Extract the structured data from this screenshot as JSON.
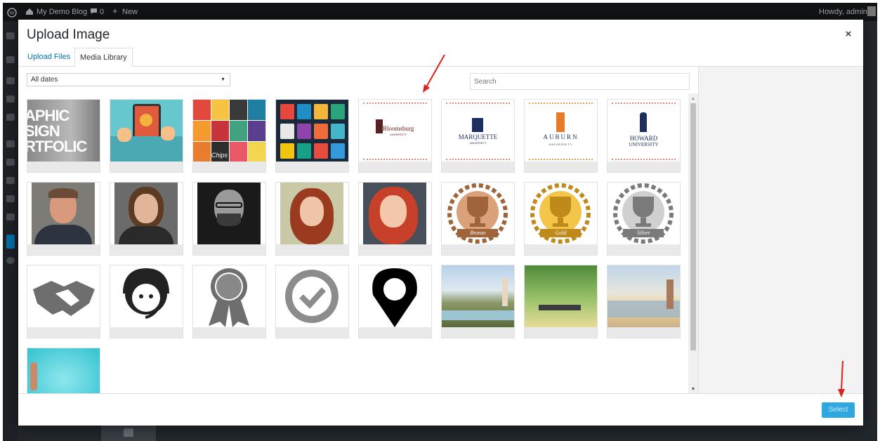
{
  "adminbar": {
    "site_name": "My Demo Blog",
    "comments_count": "0",
    "new_label": "New",
    "greeting": "Howdy, admin"
  },
  "modal": {
    "title": "Upload Image",
    "close_label": "×",
    "tabs": [
      {
        "label": "Upload Files"
      },
      {
        "label": "Media Library"
      }
    ],
    "active_tab": "Media Library",
    "filter_select": {
      "value": "All dates"
    },
    "search": {
      "placeholder": "Search"
    },
    "select_button": "Select"
  },
  "media_items": [
    {
      "name": "graphic-design-portfolio",
      "text": "APHIC SIGN RTFOLIC"
    },
    {
      "name": "tablet-gears-illustration"
    },
    {
      "name": "colorful-icon-collage",
      "text": "Chips"
    },
    {
      "name": "app-icons-grid"
    },
    {
      "name": "bloomsburg-logo",
      "text": "Bloomsburg",
      "subtext": "UNIVERSITY"
    },
    {
      "name": "marquette-logo",
      "text": "MARQUETTE",
      "subtext": "UNIVERSITY"
    },
    {
      "name": "auburn-logo",
      "text": "AUBURN",
      "subtext": "UNIVERSITY"
    },
    {
      "name": "howard-logo",
      "text": "HOWARD",
      "subtext": "UNIVERSITY"
    },
    {
      "name": "portrait-man-suit"
    },
    {
      "name": "portrait-smiling-woman"
    },
    {
      "name": "portrait-bearded-man-bw"
    },
    {
      "name": "portrait-curly-hair-woman"
    },
    {
      "name": "portrait-red-hair-woman"
    },
    {
      "name": "bronze-trophy-award",
      "text": "Bronze"
    },
    {
      "name": "gold-trophy-award",
      "text": "Gold"
    },
    {
      "name": "silver-trophy-award",
      "text": "Silver"
    },
    {
      "name": "handshake-icon"
    },
    {
      "name": "headset-support-icon"
    },
    {
      "name": "award-ribbon-icon"
    },
    {
      "name": "checkmark-badge-icon"
    },
    {
      "name": "map-pin-icon"
    },
    {
      "name": "yoga-lake-photo"
    },
    {
      "name": "yoga-group-outdoor-photo"
    },
    {
      "name": "yoga-sunset-photo"
    },
    {
      "name": "woman-by-water-photo"
    }
  ],
  "colors": {
    "accent": "#0073aa",
    "select_button": "#2fa8e0",
    "admin_bg": "#23282d",
    "annotation_arrow": "#e0201a"
  }
}
